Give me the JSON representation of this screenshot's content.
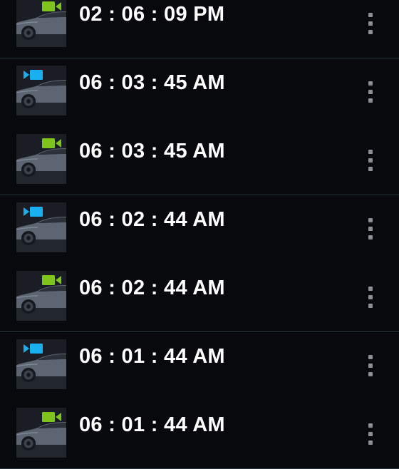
{
  "colors": {
    "background": "#07090d",
    "divider": "#2a3740",
    "front_camera_icon": "#1ab0f0",
    "rear_camera_icon": "#7fc31c",
    "menu_dots": "#8c9094",
    "time_text": "#ffffff"
  },
  "recordings": [
    {
      "time": "02 : 06 : 09 PM",
      "camera": "rear",
      "icon": "rear-camera-icon"
    },
    {
      "time": "06 : 03 : 45 AM",
      "camera": "front",
      "icon": "front-camera-icon"
    },
    {
      "time": "06 : 03 : 45 AM",
      "camera": "rear",
      "icon": "rear-camera-icon"
    },
    {
      "time": "06 : 02 : 44 AM",
      "camera": "front",
      "icon": "front-camera-icon"
    },
    {
      "time": "06 : 02 : 44 AM",
      "camera": "rear",
      "icon": "rear-camera-icon"
    },
    {
      "time": "06 : 01 : 44 AM",
      "camera": "front",
      "icon": "front-camera-icon"
    },
    {
      "time": "06 : 01 : 44 AM",
      "camera": "rear",
      "icon": "rear-camera-icon"
    }
  ],
  "row_menu_icon": "more-vertical-icon"
}
